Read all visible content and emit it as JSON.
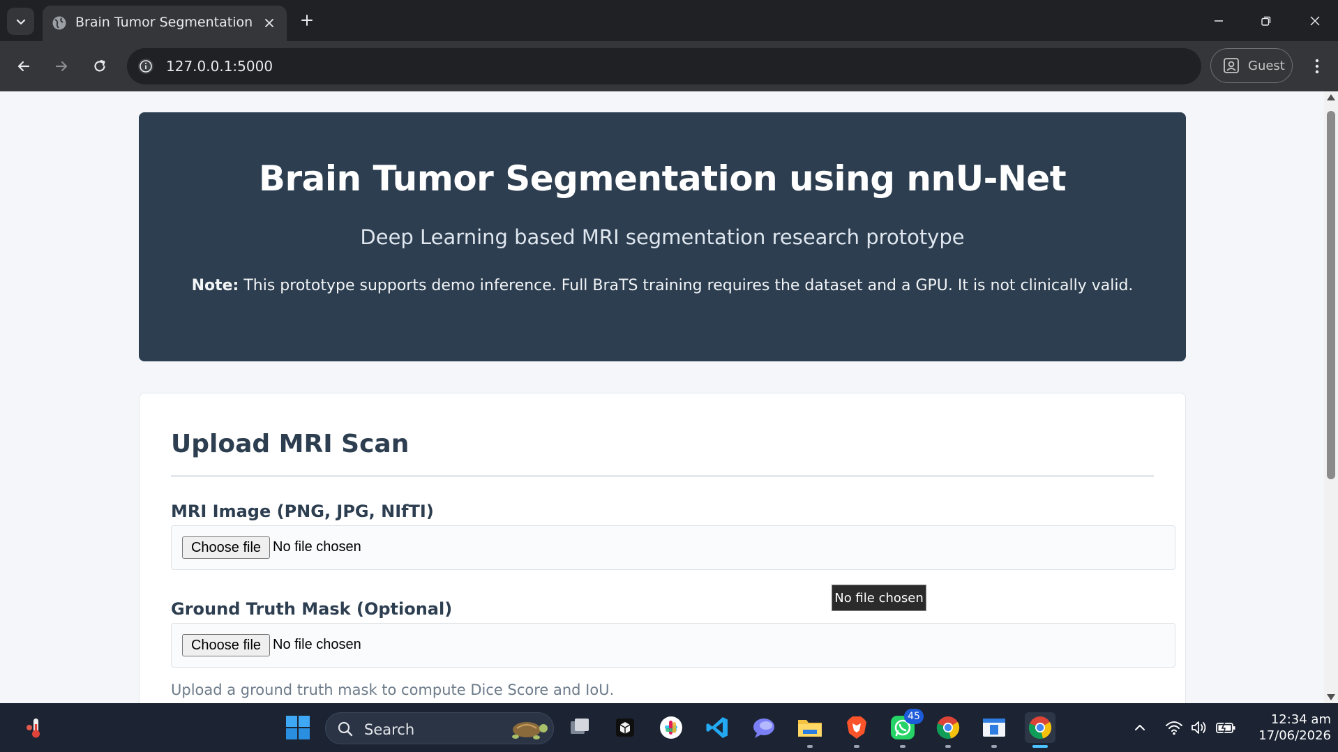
{
  "browser": {
    "tab_title": "Brain Tumor Segmentation",
    "url": "127.0.0.1:5000",
    "profile_label": "Guest"
  },
  "page": {
    "header": {
      "title": "Brain Tumor Segmentation using nnU-Net",
      "subtitle": "Deep Learning based MRI segmentation research prototype",
      "note_label": "Note:",
      "note_text": " This prototype supports demo inference. Full BraTS training requires the dataset and a GPU. It is not clinically valid.",
      "background_color": "#2c3e50"
    },
    "upload": {
      "heading": "Upload MRI Scan",
      "mri_field": {
        "label": "MRI Image (PNG, JPG, NIfTI)",
        "button_label": "Choose file",
        "status": "No file chosen"
      },
      "mask_field": {
        "label": "Ground Truth Mask (Optional)",
        "button_label": "Choose file",
        "status": "No file chosen"
      },
      "hint": "Upload a ground truth mask to compute Dice Score and IoU."
    },
    "tooltip": "No file chosen"
  },
  "taskbar": {
    "search_label": "Search",
    "whatsapp_badge": "45",
    "clock_time": "12:34 am",
    "clock_date": "17/06/2026",
    "accent_color": "#4cc2ff"
  }
}
